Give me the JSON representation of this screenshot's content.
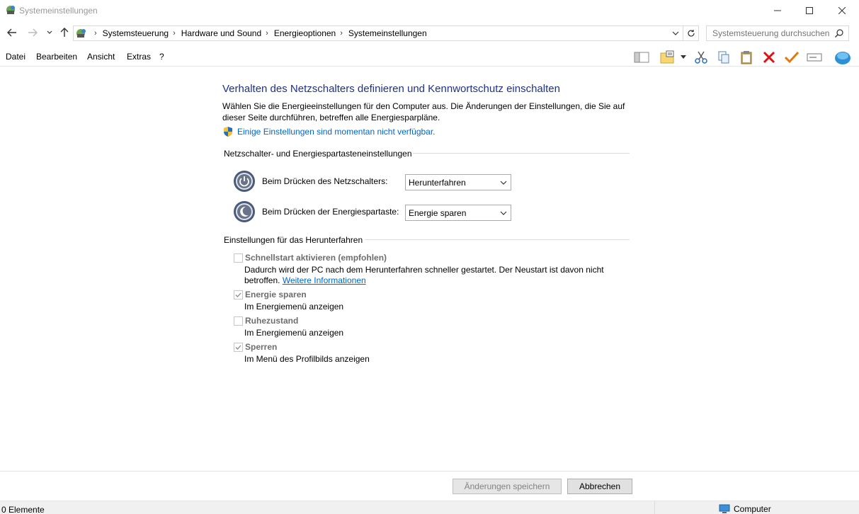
{
  "window": {
    "title": "Systemeinstellungen"
  },
  "nav": {
    "breadcrumbs": [
      "Systemsteuerung",
      "Hardware und Sound",
      "Energieoptionen",
      "Systemeinstellungen"
    ],
    "search_placeholder": "Systemsteuerung durchsuchen"
  },
  "menu": {
    "items": [
      "Datei",
      "Bearbeiten",
      "Ansicht",
      "Extras",
      "?"
    ]
  },
  "content": {
    "heading": "Verhalten des Netzschalters definieren und Kennwortschutz einschalten",
    "description": "Wählen Sie die Energieeinstellungen für den Computer aus. Die Änderungen der Einstellungen, die Sie auf dieser Seite durchführen, betreffen alle Energiesparpläne.",
    "unavailable_link": "Einige Einstellungen sind momentan nicht verfügbar.",
    "group_power": "Netzschalter- und Energiespartasteneinstellungen",
    "power_button_label": "Beim Drücken des Netzschalters:",
    "power_button_value": "Herunterfahren",
    "sleep_button_label": "Beim Drücken der Energiespartaste:",
    "sleep_button_value": "Energie sparen",
    "group_shutdown": "Einstellungen für das Herunterfahren",
    "options": [
      {
        "title": "Schnellstart aktivieren (empfohlen)",
        "desc_line1": "Dadurch wird der PC nach dem Herunterfahren schneller gestartet. Der Neustart ist davon nicht",
        "desc_line2": "betroffen.",
        "link": "Weitere Informationen",
        "checked": false
      },
      {
        "title": "Energie sparen",
        "desc": "Im Energiemenü anzeigen",
        "checked": true
      },
      {
        "title": "Ruhezustand",
        "desc": "Im Energiemenü anzeigen",
        "checked": false
      },
      {
        "title": "Sperren",
        "desc": "Im Menü des Profilbilds anzeigen",
        "checked": true
      }
    ]
  },
  "buttons": {
    "save": "Änderungen speichern",
    "cancel": "Abbrechen"
  },
  "status": {
    "items": "0 Elemente",
    "location": "Computer"
  },
  "colors": {
    "heading": "#1e3287",
    "link": "#0066cc",
    "disabled_text": "#6d6d6d"
  }
}
